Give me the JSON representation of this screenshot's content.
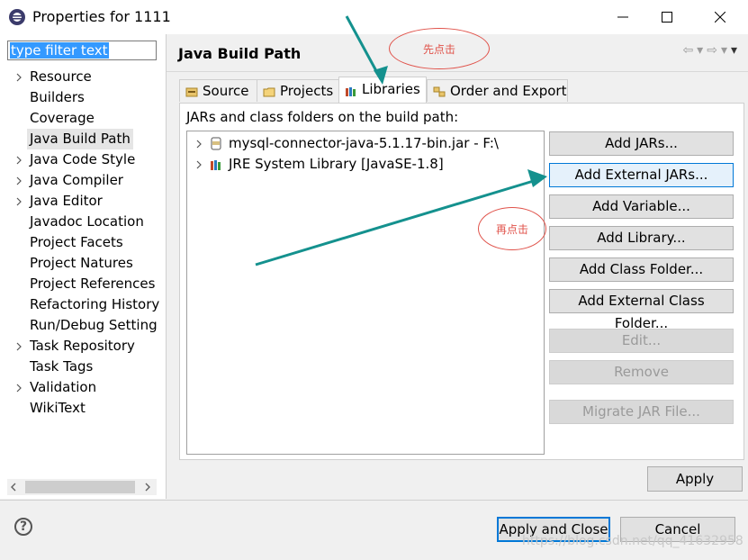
{
  "window": {
    "title": "Properties for 1111",
    "minimize": "—",
    "maximize": "☐",
    "close": "✕"
  },
  "filter": {
    "value": "type filter text"
  },
  "tree": [
    {
      "label": "Resource",
      "expandable": true
    },
    {
      "label": "Builders",
      "expandable": false
    },
    {
      "label": "Coverage",
      "expandable": false
    },
    {
      "label": "Java Build Path",
      "expandable": false,
      "selected": true
    },
    {
      "label": "Java Code Style",
      "expandable": true
    },
    {
      "label": "Java Compiler",
      "expandable": true
    },
    {
      "label": "Java Editor",
      "expandable": true
    },
    {
      "label": "Javadoc Location",
      "expandable": false
    },
    {
      "label": "Project Facets",
      "expandable": false
    },
    {
      "label": "Project Natures",
      "expandable": false
    },
    {
      "label": "Project References",
      "expandable": false
    },
    {
      "label": "Refactoring History",
      "expandable": false
    },
    {
      "label": "Run/Debug Setting",
      "expandable": false
    },
    {
      "label": "Task Repository",
      "expandable": true
    },
    {
      "label": "Task Tags",
      "expandable": false
    },
    {
      "label": "Validation",
      "expandable": true
    },
    {
      "label": "WikiText",
      "expandable": false
    }
  ],
  "page": {
    "title": "Java Build Path"
  },
  "tabs": [
    {
      "label": "Source",
      "icon": "source-folder-icon"
    },
    {
      "label": "Projects",
      "icon": "project-folder-icon"
    },
    {
      "label": "Libraries",
      "icon": "library-books-icon",
      "active": true
    },
    {
      "label": "Order and Export",
      "icon": "order-export-icon"
    }
  ],
  "panel": {
    "label": "JARs and class folders on the build path:",
    "entries": [
      {
        "label": "mysql-connector-java-5.1.17-bin.jar - F:\\",
        "icon": "jar-icon"
      },
      {
        "label": "JRE System Library [JavaSE-1.8]",
        "icon": "library-books-icon"
      }
    ],
    "buttons": [
      {
        "label": "Add JARs...",
        "enabled": true
      },
      {
        "label": "Add External JARs...",
        "enabled": true,
        "focused": true
      },
      {
        "label": "Add Variable...",
        "enabled": true
      },
      {
        "label": "Add Library...",
        "enabled": true
      },
      {
        "label": "Add Class Folder...",
        "enabled": true
      },
      {
        "label": "Add External Class Folder...",
        "enabled": true
      },
      {
        "label": "Edit...",
        "enabled": false
      },
      {
        "label": "Remove",
        "enabled": false
      },
      {
        "label": "Migrate JAR File...",
        "enabled": false
      }
    ]
  },
  "apply": {
    "label": "Apply"
  },
  "footer": {
    "help": "?",
    "apply_close": "Apply and Close",
    "cancel": "Cancel"
  },
  "annotations": {
    "first": "先点击",
    "second": "再点击"
  },
  "watermark": "https://blog.csdn.net/qq_41632958",
  "colors": {
    "accent": "#0078d7",
    "annotation": "#e0524a",
    "arrow": "#14918e",
    "selection": "#3399ff"
  }
}
